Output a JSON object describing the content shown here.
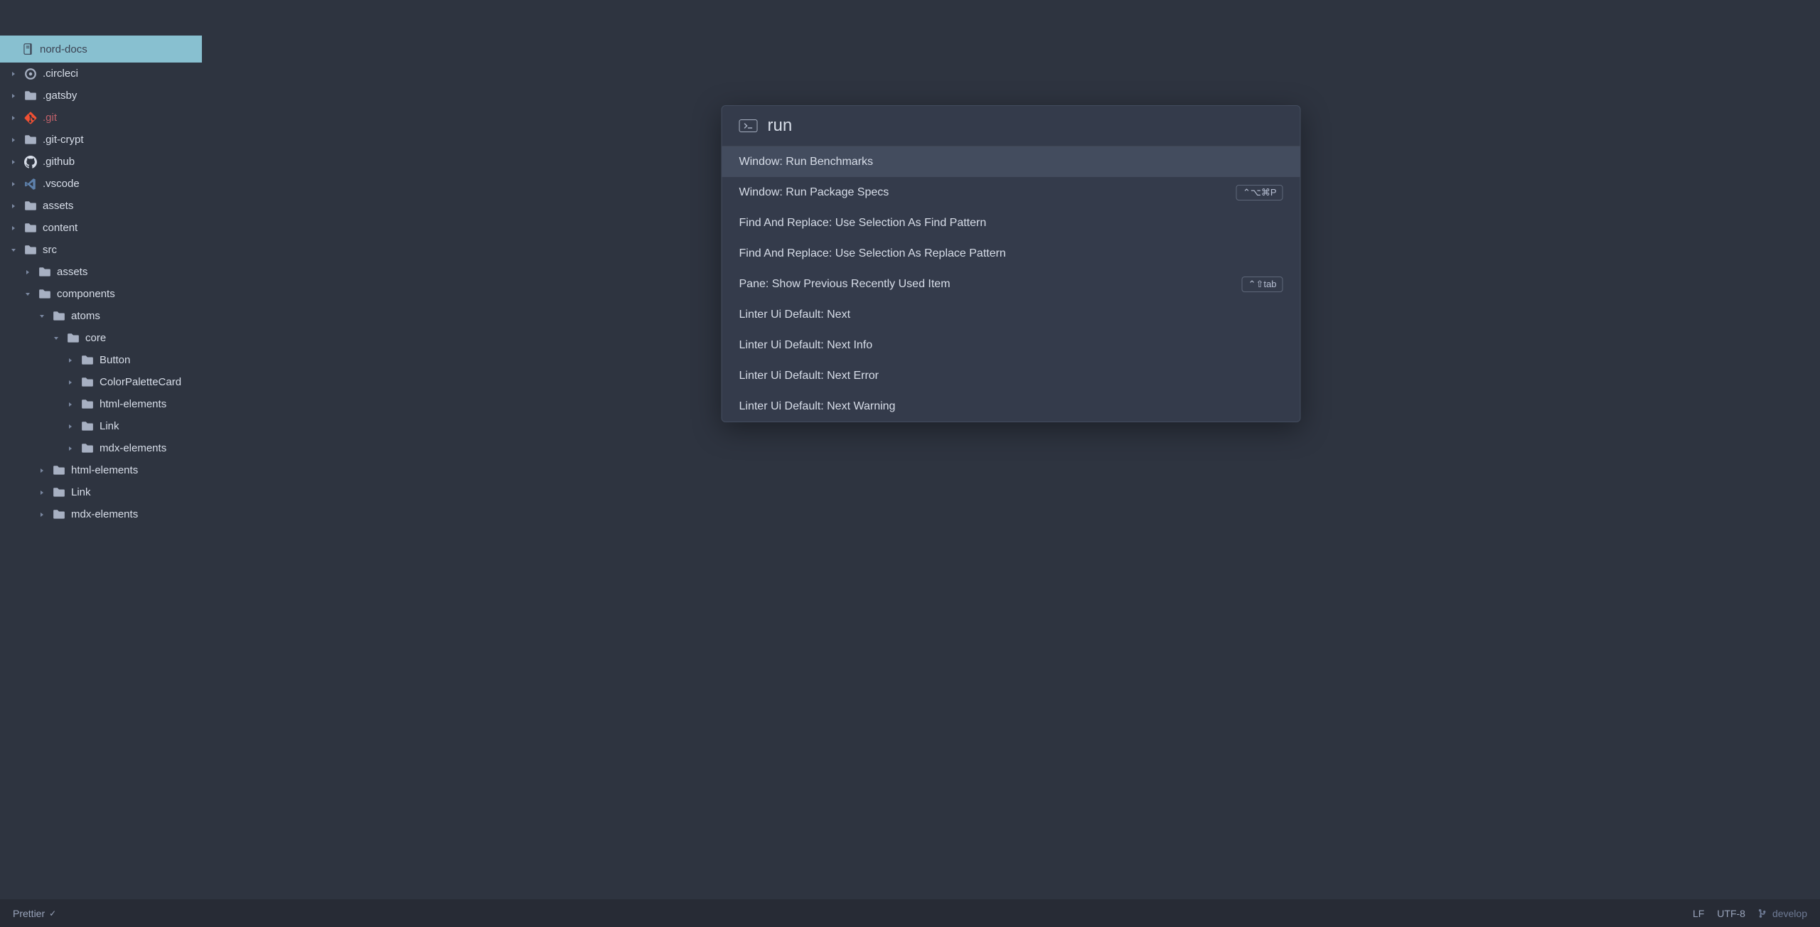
{
  "project_name": "nord-docs",
  "palette": {
    "query": "run",
    "items": [
      {
        "label": "Window: Run Benchmarks",
        "shortcut": "",
        "selected": true
      },
      {
        "label": "Window: Run Package Specs",
        "shortcut": "⌃⌥⌘P",
        "selected": false
      },
      {
        "label": "Find And Replace: Use Selection As Find Pattern",
        "shortcut": "",
        "selected": false
      },
      {
        "label": "Find And Replace: Use Selection As Replace Pattern",
        "shortcut": "",
        "selected": false
      },
      {
        "label": "Pane: Show Previous Recently Used Item",
        "shortcut": "⌃⇧tab",
        "selected": false
      },
      {
        "label": "Linter Ui Default: Next",
        "shortcut": "",
        "selected": false
      },
      {
        "label": "Linter Ui Default: Next Info",
        "shortcut": "",
        "selected": false
      },
      {
        "label": "Linter Ui Default: Next Error",
        "shortcut": "",
        "selected": false
      },
      {
        "label": "Linter Ui Default: Next Warning",
        "shortcut": "",
        "selected": false
      }
    ]
  },
  "tree": [
    {
      "label": ".circleci",
      "depth": 0,
      "expanded": false,
      "icon": "circleci"
    },
    {
      "label": ".gatsby",
      "depth": 0,
      "expanded": false,
      "icon": "folder"
    },
    {
      "label": ".git",
      "depth": 0,
      "expanded": false,
      "icon": "git",
      "git": true
    },
    {
      "label": ".git-crypt",
      "depth": 0,
      "expanded": false,
      "icon": "folder"
    },
    {
      "label": ".github",
      "depth": 0,
      "expanded": false,
      "icon": "github"
    },
    {
      "label": ".vscode",
      "depth": 0,
      "expanded": false,
      "icon": "vscode"
    },
    {
      "label": "assets",
      "depth": 0,
      "expanded": false,
      "icon": "folder"
    },
    {
      "label": "content",
      "depth": 0,
      "expanded": false,
      "icon": "folder"
    },
    {
      "label": "src",
      "depth": 0,
      "expanded": true,
      "icon": "folder"
    },
    {
      "label": "assets",
      "depth": 1,
      "expanded": false,
      "icon": "folder"
    },
    {
      "label": "components",
      "depth": 1,
      "expanded": true,
      "icon": "folder"
    },
    {
      "label": "atoms",
      "depth": 2,
      "expanded": true,
      "icon": "folder"
    },
    {
      "label": "core",
      "depth": 3,
      "expanded": true,
      "icon": "folder"
    },
    {
      "label": "Button",
      "depth": 4,
      "expanded": false,
      "icon": "folder"
    },
    {
      "label": "ColorPaletteCard",
      "depth": 4,
      "expanded": false,
      "icon": "folder"
    },
    {
      "label": "html-elements",
      "depth": 4,
      "expanded": false,
      "icon": "folder"
    },
    {
      "label": "Link",
      "depth": 4,
      "expanded": false,
      "icon": "folder"
    },
    {
      "label": "mdx-elements",
      "depth": 4,
      "expanded": false,
      "icon": "folder"
    },
    {
      "label": "html-elements",
      "depth": 2,
      "expanded": false,
      "icon": "folder"
    },
    {
      "label": "Link",
      "depth": 2,
      "expanded": false,
      "icon": "folder"
    },
    {
      "label": "mdx-elements",
      "depth": 2,
      "expanded": false,
      "icon": "folder"
    }
  ],
  "status": {
    "prettier": "Prettier",
    "line_ending": "LF",
    "encoding": "UTF-8",
    "branch": "develop"
  }
}
